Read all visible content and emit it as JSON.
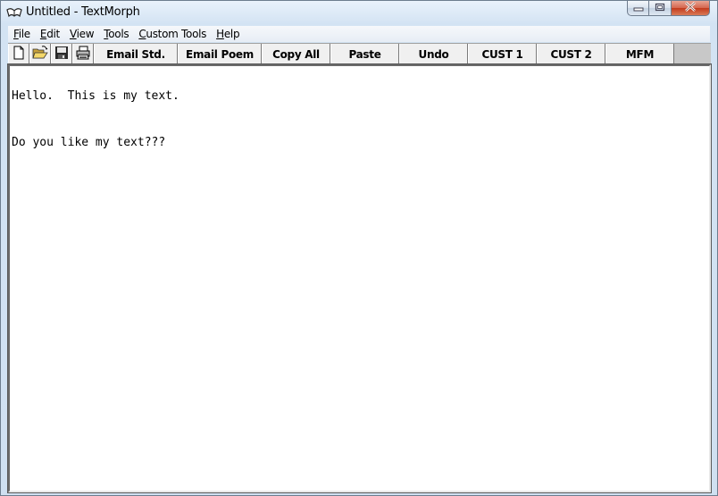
{
  "window": {
    "title": "Untitled - TextMorph",
    "app_icon": "book-icon",
    "controls": [
      "minimize-icon",
      "maximize-icon",
      "close-icon"
    ]
  },
  "menubar": {
    "items": [
      {
        "label": "File",
        "accel": "F",
        "rest": "ile"
      },
      {
        "label": "Edit",
        "accel": "E",
        "rest": "dit"
      },
      {
        "label": "View",
        "accel": "V",
        "rest": "iew"
      },
      {
        "label": "Tools",
        "accel": "T",
        "rest": "ools"
      },
      {
        "label": "Custom Tools",
        "accel": "C",
        "rest": "ustom Tools"
      },
      {
        "label": "Help",
        "accel": "H",
        "rest": "elp"
      }
    ]
  },
  "toolbar": {
    "icons": [
      "new-file-icon",
      "open-folder-icon",
      "save-disk-icon",
      "print-icon"
    ],
    "buttons": [
      {
        "label": "Email Std."
      },
      {
        "label": "Email Poem"
      },
      {
        "label": "Copy All"
      },
      {
        "label": "Paste"
      },
      {
        "label": "Undo"
      },
      {
        "label": "CUST 1"
      },
      {
        "label": "CUST 2"
      },
      {
        "label": "MFM"
      }
    ]
  },
  "editor": {
    "lines": [
      "Hello.  This is my text.",
      "Do you like my text???"
    ]
  }
}
